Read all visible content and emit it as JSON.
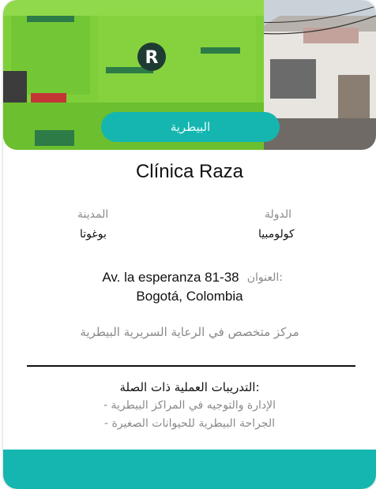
{
  "card": {
    "badge": "البيطرية",
    "title": "Clínica Raza",
    "country_label": "الدولة",
    "country_value": "كولومبيا",
    "city_label": "المدينة",
    "city_value": "بوغوتا",
    "address_label": "العنوان:",
    "address_line1": "Av. la esperanza 81-38",
    "address_line2": "Bogotá, Colombia",
    "description": "مركز متخصص في الرعاية السريرية البيطرية",
    "trainings_title": "التدريبات العملية ذات الصلة:",
    "trainings": [
      "- الإدارة والتوجيه في المراكز البيطرية",
      "- الجراحة البيطرية للحيوانات الصغيرة"
    ],
    "logo_letter": "R"
  },
  "colors": {
    "accent": "#15b6b0",
    "storefront": "#7fcf3a"
  }
}
